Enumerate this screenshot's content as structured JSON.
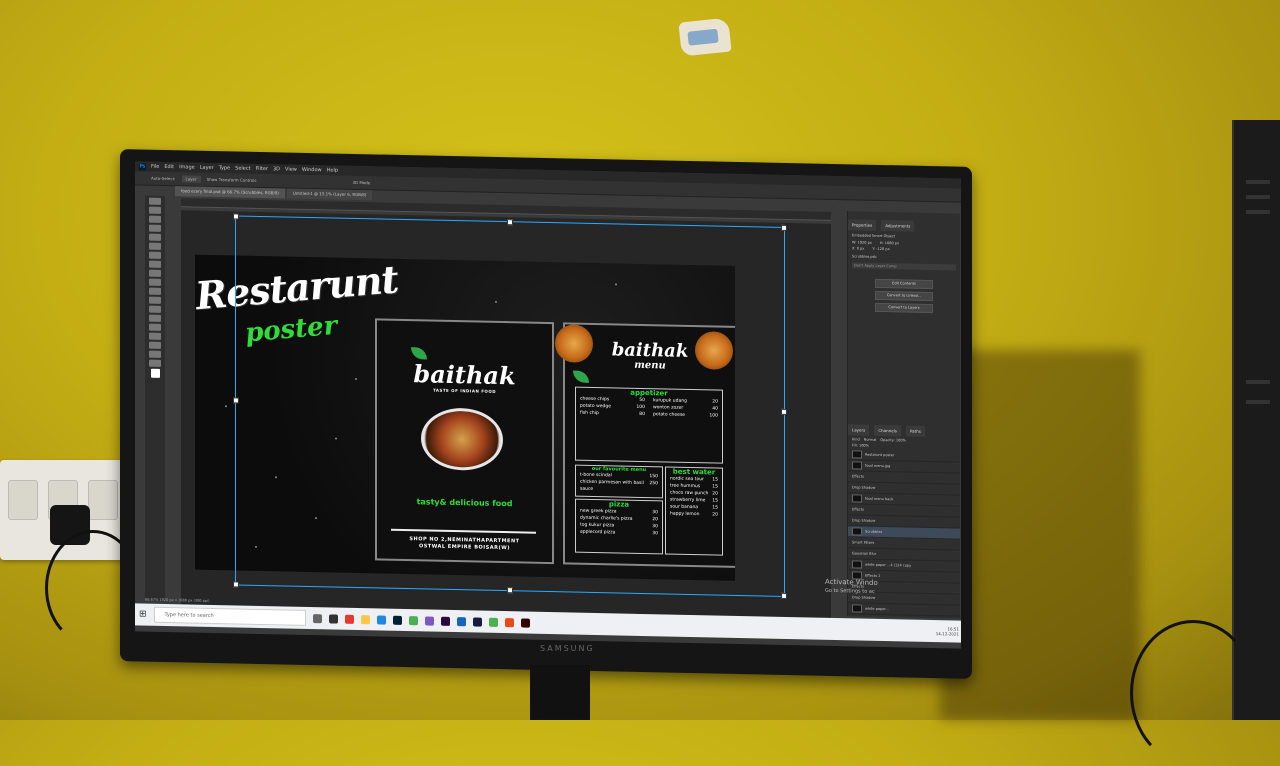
{
  "menubar": {
    "items": [
      "File",
      "Edit",
      "Image",
      "Layer",
      "Type",
      "Select",
      "Filter",
      "3D",
      "View",
      "Window",
      "Help"
    ]
  },
  "tabs": [
    "food ecery final.psd @ 66.7% (Scrubbles, RGB/8)",
    "Untitled-1 @ 15.1% (Layer 6, RGB/8)"
  ],
  "options_bar": {
    "auto_select": "Auto-Select:",
    "layer": "Layer",
    "transform": "Show Transform Controls",
    "mode": "3D Mode"
  },
  "poster": {
    "title": "Restarunt",
    "subtitle": "poster",
    "card1": {
      "brand": "baithak",
      "brand_tagline": "TASTE OF INDIAN FOOD",
      "tagline": "tasty& delicious food",
      "address_line1": "SHOP NO 2,NEMINATHAPARTMENT",
      "address_line2": "OSTWAL EMPIRE BOISAR(W)"
    },
    "card2": {
      "brand": "baithak",
      "menu": "menu",
      "appetizer_head": "appetizer",
      "appetizers_left": [
        [
          "cheese chips",
          "50"
        ],
        [
          "potato wedge",
          "100"
        ],
        [
          "fish chip",
          "80"
        ]
      ],
      "appetizers_right": [
        [
          "kurupuk udang",
          "20"
        ],
        [
          "wonton zozer",
          "40"
        ],
        [
          "potato cheese",
          "100"
        ]
      ],
      "favourites_head": "our favourite menu",
      "favourites": [
        [
          "t-bone scindal",
          "150"
        ],
        [
          "chicken parmesan with basil sauce",
          "250"
        ]
      ],
      "water_head": "best water",
      "water": [
        [
          "nordic sea tour",
          "15"
        ],
        [
          "tree hummus",
          "15"
        ],
        [
          "choco raw punch",
          "20"
        ],
        [
          "strawberry lime",
          "15"
        ],
        [
          "sour banana",
          "15"
        ],
        [
          "happy lemon",
          "20"
        ]
      ],
      "pizza_head": "pizza",
      "pizza": [
        [
          "new greek pizza",
          "30"
        ],
        [
          "dynamic charlie's pizza",
          "20"
        ],
        [
          "tog kukur pizza",
          "30"
        ],
        [
          "applecord pizza",
          "30"
        ]
      ]
    }
  },
  "right_panel": {
    "tabs": [
      "Properties",
      "Adjustments"
    ],
    "object_type": "Embedded Smart Object",
    "w": "W: 1920 px",
    "h": "H: 1080 px",
    "x": "X: 0 px",
    "y": "Y: -120 px",
    "filename": "Scrubbles.psb",
    "placeholder": "Don't Apply Layer Comp",
    "buttons": [
      "Edit Contents",
      "Convert to Linked...",
      "Convert to Layers"
    ],
    "layer_tabs": [
      "Layers",
      "Channels",
      "Paths"
    ],
    "kind": "Kind",
    "blend": "Normal",
    "opacity": "Opacity: 100%",
    "fill": "Fill: 100%",
    "layers": [
      "Restarunt poster",
      "food menu.jpg",
      "Effects",
      "Drop Shadow",
      "food menu back",
      "Effects",
      "Drop Shadow",
      "Scrubbles",
      "Smart Filters",
      "Gaussian Blur",
      "white paper ...4 (124 copy",
      "Effects 1",
      "Effects",
      "Drop Shadow",
      "white paper..."
    ]
  },
  "status": "66.67%   1920 px x 1080 px (300 ppi)",
  "watermark": {
    "line1": "Activate Windo",
    "line2": "Go to Settings to ac"
  },
  "taskbar": {
    "search_placeholder": "Type here to search",
    "time": "16:51",
    "date": "14-12-2021"
  },
  "monitor_brand": "SAMSUNG",
  "colors": {
    "wall": "#c3ad14",
    "accent_green": "#2edc3a",
    "selection": "#2aa9ff"
  }
}
